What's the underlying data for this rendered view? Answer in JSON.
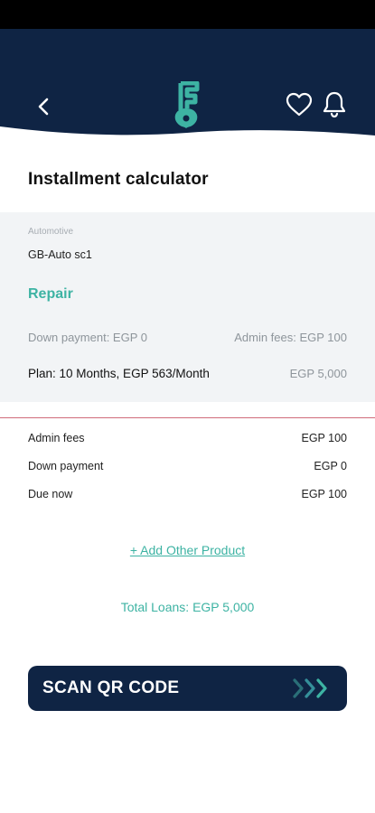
{
  "header": {
    "back_icon": "chevron-left-icon",
    "logo_icon": "key-logo-icon",
    "favorite_icon": "heart-icon",
    "notification_icon": "bell-icon",
    "bg_color": "#0f2444",
    "accent_color": "#3db3a3"
  },
  "page": {
    "title": "Installment calculator"
  },
  "product": {
    "category": "Automotive",
    "name": "GB-Auto sc1",
    "service": "Repair",
    "down_payment": "Down payment: EGP 0",
    "admin_fees": "Admin fees: EGP 100",
    "plan": "Plan: 10 Months, EGP 563/Month",
    "plan_amount": "EGP 5,000"
  },
  "summary": {
    "rows": [
      {
        "label": "Admin fees",
        "value": "EGP 100"
      },
      {
        "label": "Down payment",
        "value": "EGP 0"
      },
      {
        "label": "Due now",
        "value": "EGP 100"
      }
    ]
  },
  "actions": {
    "add_product": "+ Add Other Product",
    "total_loans": "Total Loans: EGP 5,000",
    "scan_button": "SCAN QR CODE",
    "scan_icon": "chevrons-right-icon"
  }
}
